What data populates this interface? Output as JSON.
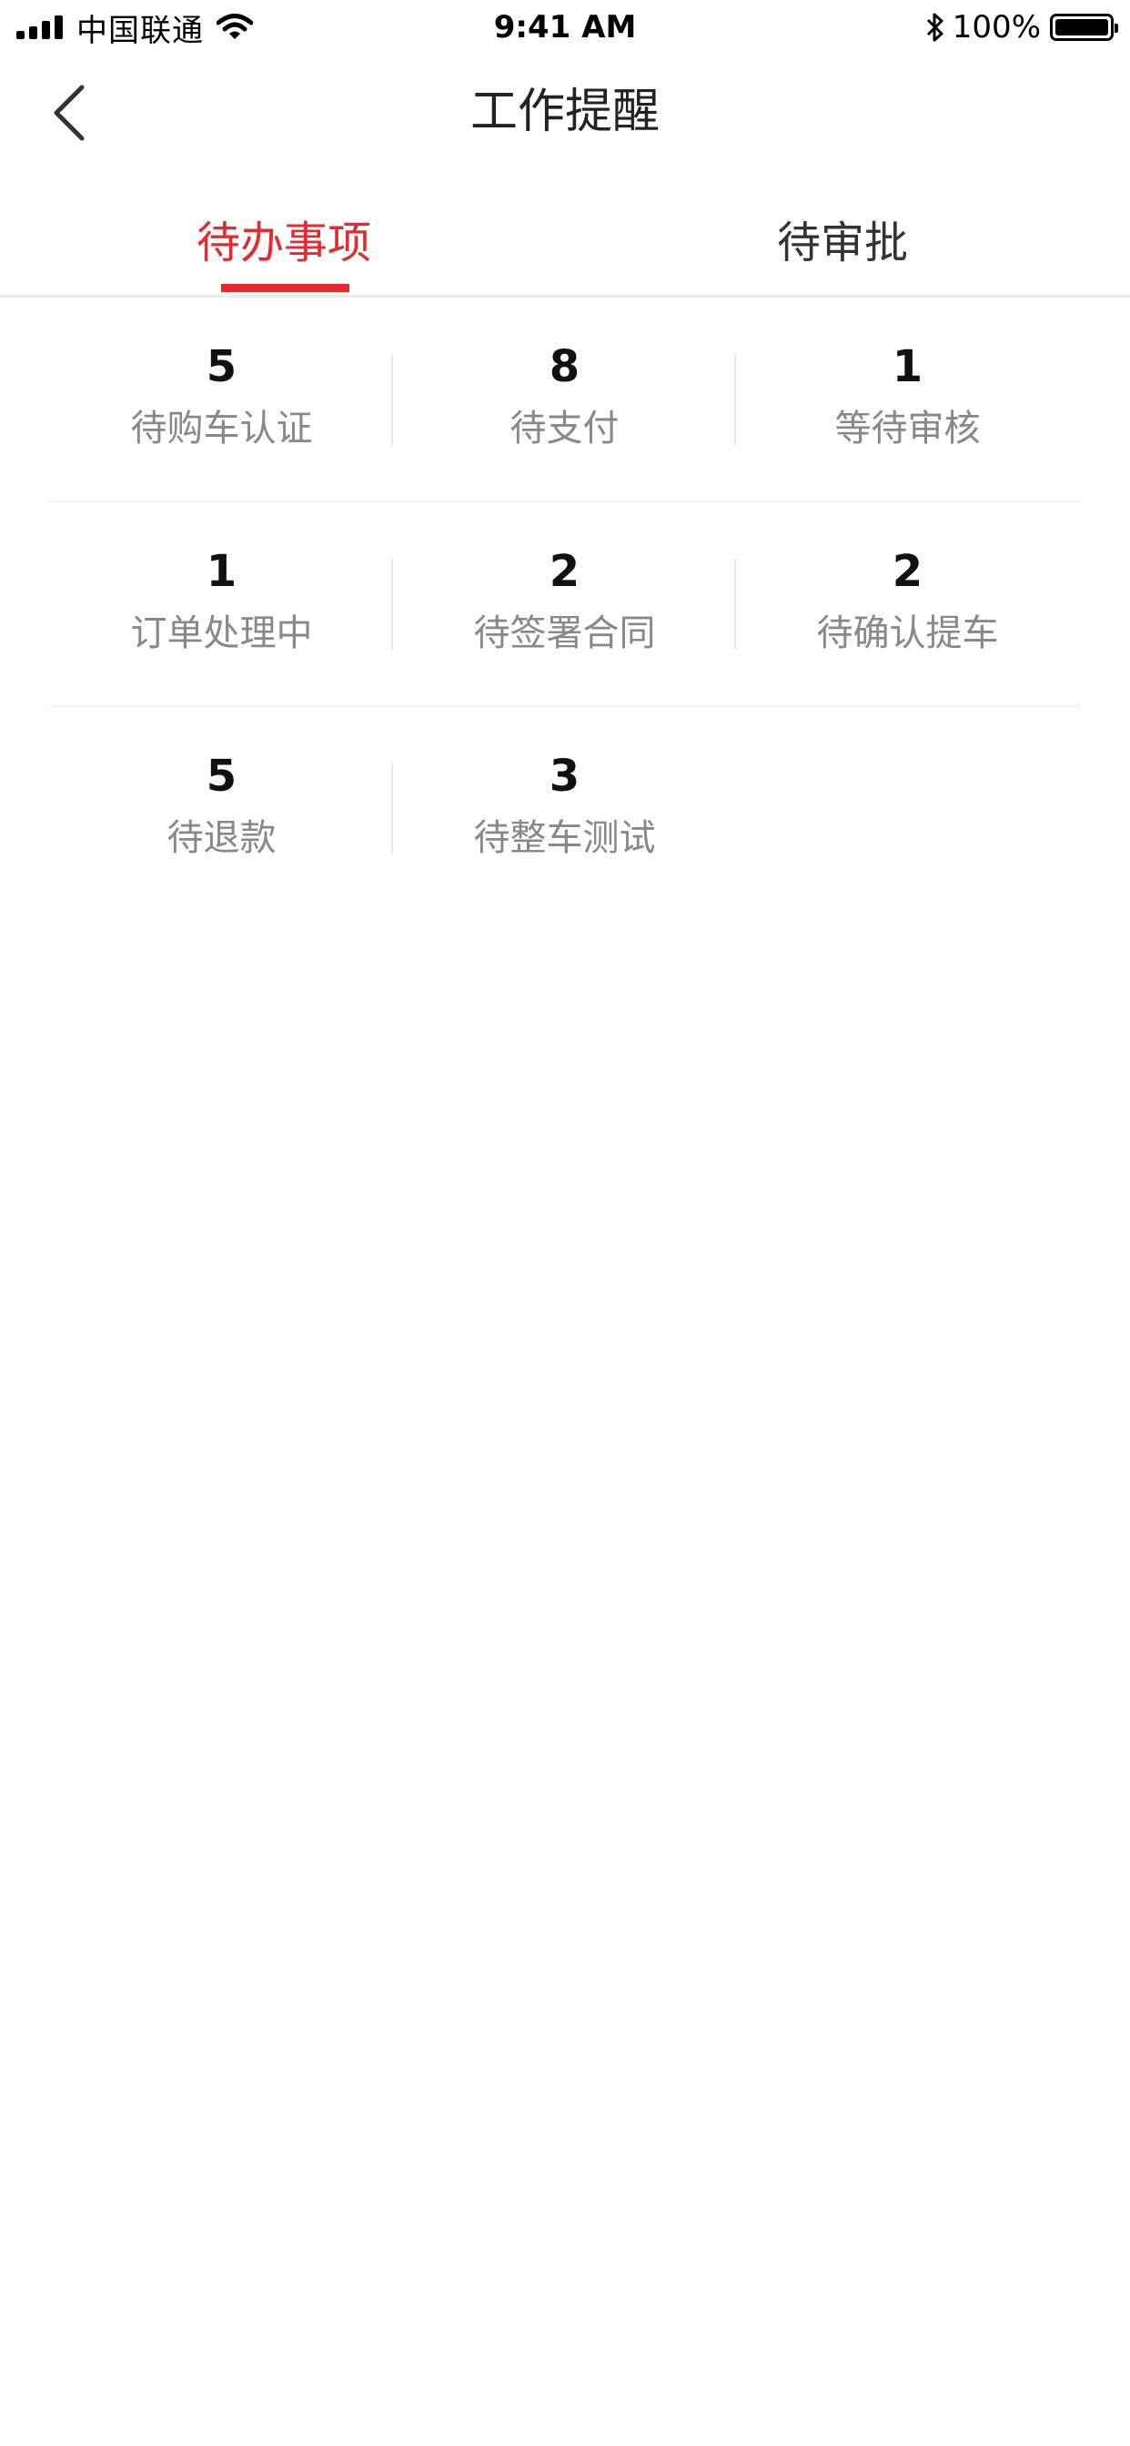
{
  "status_bar": {
    "carrier": "中国联通",
    "time": "9:41 AM",
    "battery": "100%",
    "battery_level": 1.0,
    "icons": [
      "signal-icon",
      "wifi-icon",
      "bluetooth-icon",
      "battery-icon"
    ]
  },
  "nav": {
    "title": "工作提醒",
    "back_icon": "chevron-left-icon"
  },
  "tabs": [
    {
      "label": "待办事项",
      "active": true
    },
    {
      "label": "待审批",
      "active": false
    }
  ],
  "colors": {
    "accent": "#e8282f",
    "label_gray": "#888888",
    "divider": "#f0f0f0"
  },
  "items": [
    {
      "count": "5",
      "label": "待购车认证"
    },
    {
      "count": "8",
      "label": "待支付"
    },
    {
      "count": "1",
      "label": "等待审核"
    },
    {
      "count": "1",
      "label": "订单处理中"
    },
    {
      "count": "2",
      "label": "待签署合同"
    },
    {
      "count": "2",
      "label": "待确认提车"
    },
    {
      "count": "5",
      "label": "待退款"
    },
    {
      "count": "3",
      "label": "待整车测试"
    }
  ]
}
